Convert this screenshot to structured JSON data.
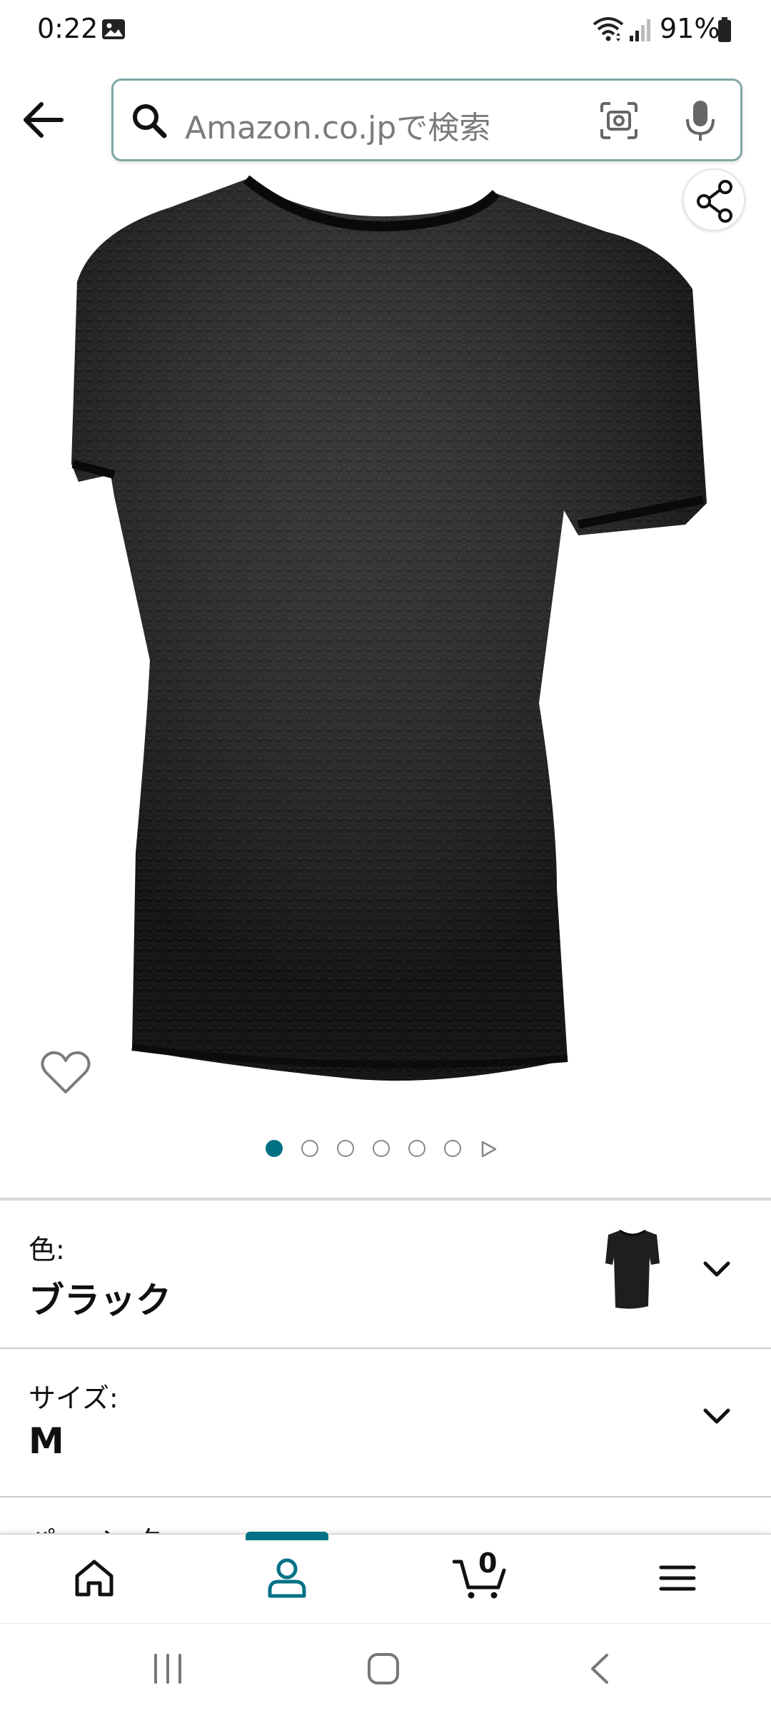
{
  "status_bar": {
    "time": "0:22",
    "battery": "91%"
  },
  "search": {
    "placeholder": "Amazon.co.jpで検索"
  },
  "carousel": {
    "total_images": 6,
    "active_index": 0
  },
  "options": {
    "color_label": "色:",
    "color_value": "ブラック",
    "size_label": "サイズ:",
    "size_value": "M",
    "next_label_partial": "パ ー ン タ"
  },
  "bottom_nav": {
    "items": [
      "home-icon",
      "account-icon",
      "cart-icon",
      "menu-icon"
    ],
    "active": "account-icon",
    "cart_count": "0"
  },
  "colors": {
    "accent": "#007185",
    "search_border": "#7fa8a6",
    "divider": "#d5d9d9"
  }
}
